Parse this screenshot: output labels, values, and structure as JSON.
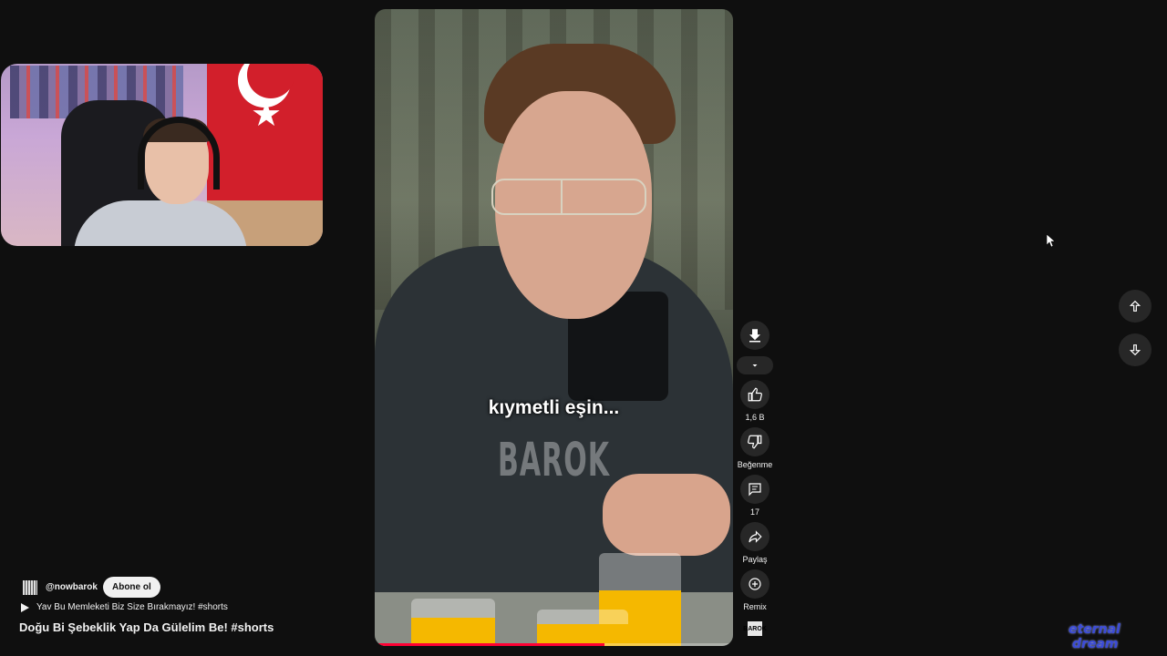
{
  "video": {
    "caption": "kıymetli eşin...",
    "watermark": "BAROK",
    "progress_fraction": 0.64
  },
  "actions": {
    "like_count": "1,6 B",
    "dislike_label": "Beğenme",
    "comment_count": "17",
    "share_label": "Paylaş",
    "remix_label": "Remix",
    "channel_badge": "BAROK"
  },
  "channel": {
    "handle": "@nowbarok",
    "subscribe_label": "Abone ol"
  },
  "playlist": {
    "label": "Yav Bu Memleketi Biz Size Bırakmayız! #shorts"
  },
  "short": {
    "title": "Doğu Bi Şebeklik Yap Da Gülelim Be! #shorts"
  },
  "logo": {
    "line1": "eternal",
    "line2": "dream"
  },
  "colors": {
    "background": "#0f0f0f",
    "button_bg": "#272727",
    "progress": "#ff0033"
  },
  "icons": [
    "download-icon",
    "dropdown-icon",
    "like-icon",
    "dislike-icon",
    "comment-icon",
    "share-icon",
    "remix-icon",
    "arrow-up-icon",
    "arrow-down-icon",
    "play-icon",
    "cursor-icon"
  ]
}
